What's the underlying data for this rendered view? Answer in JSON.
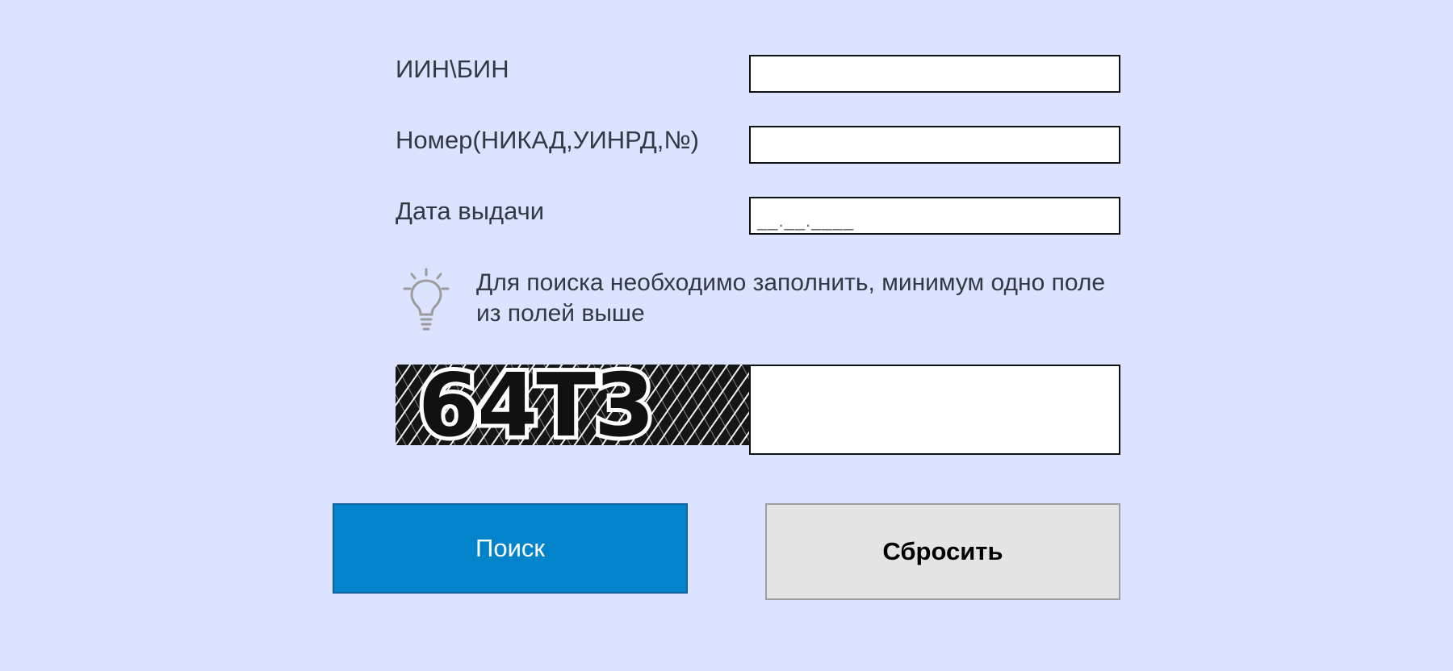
{
  "form": {
    "iin_label": "ИИН\\БИН",
    "iin_value": "",
    "number_label": "Номер(НИКАД,УИНРД,№)",
    "number_value": "",
    "date_label": "Дата выдачи",
    "date_placeholder": "__.__.____",
    "date_value": ""
  },
  "hint": {
    "icon": "lightbulb-icon",
    "text": "Для поиска необходимо заполнить, минимум одно поле из полей выше"
  },
  "captcha": {
    "text": "64T3",
    "input_value": ""
  },
  "buttons": {
    "search_label": "Поиск",
    "reset_label": "Сбросить"
  },
  "colors": {
    "background": "#dbe3ff",
    "primary": "#0383c9",
    "secondary": "#e4e4e4"
  }
}
